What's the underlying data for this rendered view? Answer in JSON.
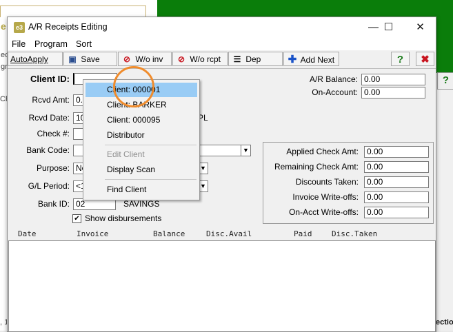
{
  "background": {
    "fragment_1": "e",
    "fragment_2": "ec",
    "fragment_3": "gra",
    "fragment_4": "Ch",
    "fragment_5": ", 1",
    "fragment_6": "ectio",
    "help_glyph": "?"
  },
  "window": {
    "app_icon": "e3",
    "title": "A/R Receipts Editing",
    "minimize": "—",
    "maximize": "☐",
    "close": "✕"
  },
  "menu": [
    "File",
    "Program",
    "Sort"
  ],
  "toolbar": {
    "autoapply": "AutoApply",
    "save": "Save",
    "wo_inv": "W/o inv",
    "wo_rcpt": "W/o rcpt",
    "dep": "Dep",
    "add_next": "Add Next",
    "help": "?",
    "close": "✖"
  },
  "form": {
    "client_id_label": "Client ID:",
    "client_id_value": "",
    "rcvd_amt_label": "Rcvd Amt:",
    "rcvd_amt_value": "0.",
    "rcvd_date_label": "Rcvd Date:",
    "rcvd_date_value": "10",
    "pl_fragment": "PL",
    "check_label": "Check #:",
    "bank_code_label": "Bank Code:",
    "purpose_label": "Purpose:",
    "purpose_value": "Ne",
    "gl_period_label": "G/L Period:",
    "gl_period_value": "<1",
    "bank_id_label": "Bank ID:",
    "bank_id_value": "02",
    "bank_name": "SAVINGS",
    "show_disbursements": "Show disbursements",
    "show_disbursements_checked": "✔"
  },
  "balances": {
    "ar_balance_label": "A/R Balance:",
    "ar_balance_value": "0.00",
    "on_account_label": "On-Account:",
    "on_account_value": "0.00"
  },
  "check_totals": [
    {
      "label": "Applied Check Amt:",
      "value": "0.00"
    },
    {
      "label": "Remaining Check Amt:",
      "value": "0.00"
    },
    {
      "label": "Discounts Taken:",
      "value": "0.00"
    },
    {
      "label": "Invoice Write-offs:",
      "value": "0.00"
    },
    {
      "label": "On-Acct Write-offs:",
      "value": "0.00"
    }
  ],
  "grid_columns": [
    "Date",
    "Invoice",
    "Balance",
    "Disc.Avail",
    "Paid",
    "Disc.Taken"
  ],
  "popup": {
    "items": [
      "Client: 000001",
      "Client: BARKER",
      "Client: 000095",
      "Distributor",
      "Edit Client",
      "Display Scan",
      "Find Client"
    ],
    "selected": "Client: 000001",
    "disabled": "Edit Client"
  },
  "colors": {
    "accent_green": "#0a7d0a",
    "highlight": "#99ccf5",
    "annotation_ring": "#f08c2c"
  }
}
